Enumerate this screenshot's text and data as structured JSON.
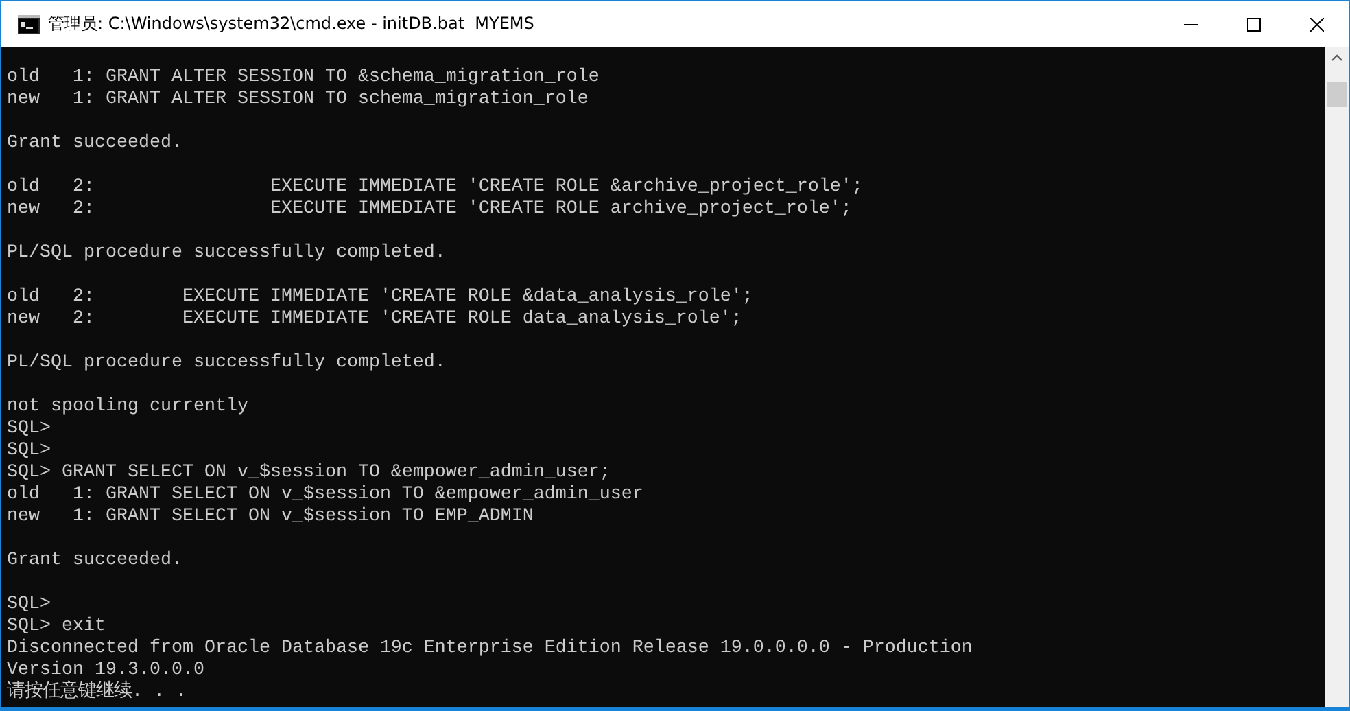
{
  "window": {
    "title": "管理员: C:\\Windows\\system32\\cmd.exe - initDB.bat  MYEMS"
  },
  "console": {
    "blocks": [
      [
        "old   1: GRANT ALTER SESSION TO &schema_migration_role",
        "new   1: GRANT ALTER SESSION TO schema_migration_role"
      ],
      [
        "Grant succeeded."
      ],
      [
        "old   2:                EXECUTE IMMEDIATE 'CREATE ROLE &archive_project_role';",
        "new   2:                EXECUTE IMMEDIATE 'CREATE ROLE archive_project_role';"
      ],
      [
        "PL/SQL procedure successfully completed."
      ],
      [
        "old   2:        EXECUTE IMMEDIATE 'CREATE ROLE &data_analysis_role';",
        "new   2:        EXECUTE IMMEDIATE 'CREATE ROLE data_analysis_role';"
      ],
      [
        "PL/SQL procedure successfully completed."
      ],
      [
        "not spooling currently",
        "SQL>",
        "SQL>",
        "SQL> GRANT SELECT ON v_$session TO &empower_admin_user;",
        "old   1: GRANT SELECT ON v_$session TO &empower_admin_user",
        "new   1: GRANT SELECT ON v_$session TO EMP_ADMIN"
      ],
      [
        "Grant succeeded."
      ],
      [
        "SQL>",
        "SQL> exit",
        "Disconnected from Oracle Database 19c Enterprise Edition Release 19.0.0.0.0 - Production",
        "Version 19.3.0.0.0",
        "请按任意键继续. . ."
      ]
    ]
  }
}
